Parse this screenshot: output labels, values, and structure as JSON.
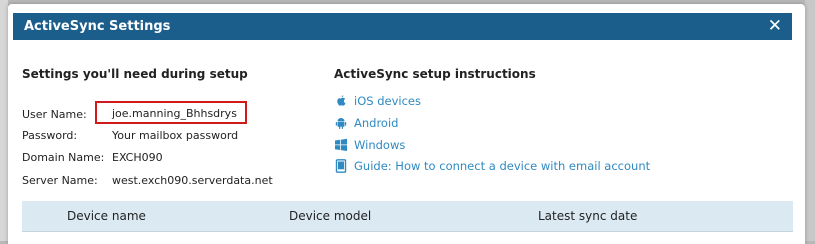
{
  "dialog": {
    "title": "ActiveSync Settings",
    "close_label": "✕"
  },
  "settings": {
    "heading": "Settings you'll need during setup",
    "rows": [
      {
        "label": "User Name:",
        "value": "joe.manning_Bhhsdrys"
      },
      {
        "label": "Password:",
        "value": "Your mailbox password"
      },
      {
        "label": "Domain Name:",
        "value": "EXCH090"
      },
      {
        "label": "Server Name:",
        "value": "west.exch090.serverdata.net"
      }
    ]
  },
  "instructions": {
    "heading": "ActiveSync setup instructions",
    "links": [
      {
        "label": "iOS devices",
        "icon": "apple-icon"
      },
      {
        "label": "Android",
        "icon": "android-icon"
      },
      {
        "label": "Windows",
        "icon": "windows-icon"
      },
      {
        "label": "Guide: How to connect a device with email account",
        "icon": "device-icon"
      }
    ]
  },
  "devices_table": {
    "columns": [
      "Device name",
      "Device model",
      "Latest sync date"
    ]
  },
  "colors": {
    "titlebar": "#1b5e8c",
    "link": "#2f8ac2",
    "highlight_border": "#d11a1a",
    "table_header": "#dbe9f2"
  }
}
